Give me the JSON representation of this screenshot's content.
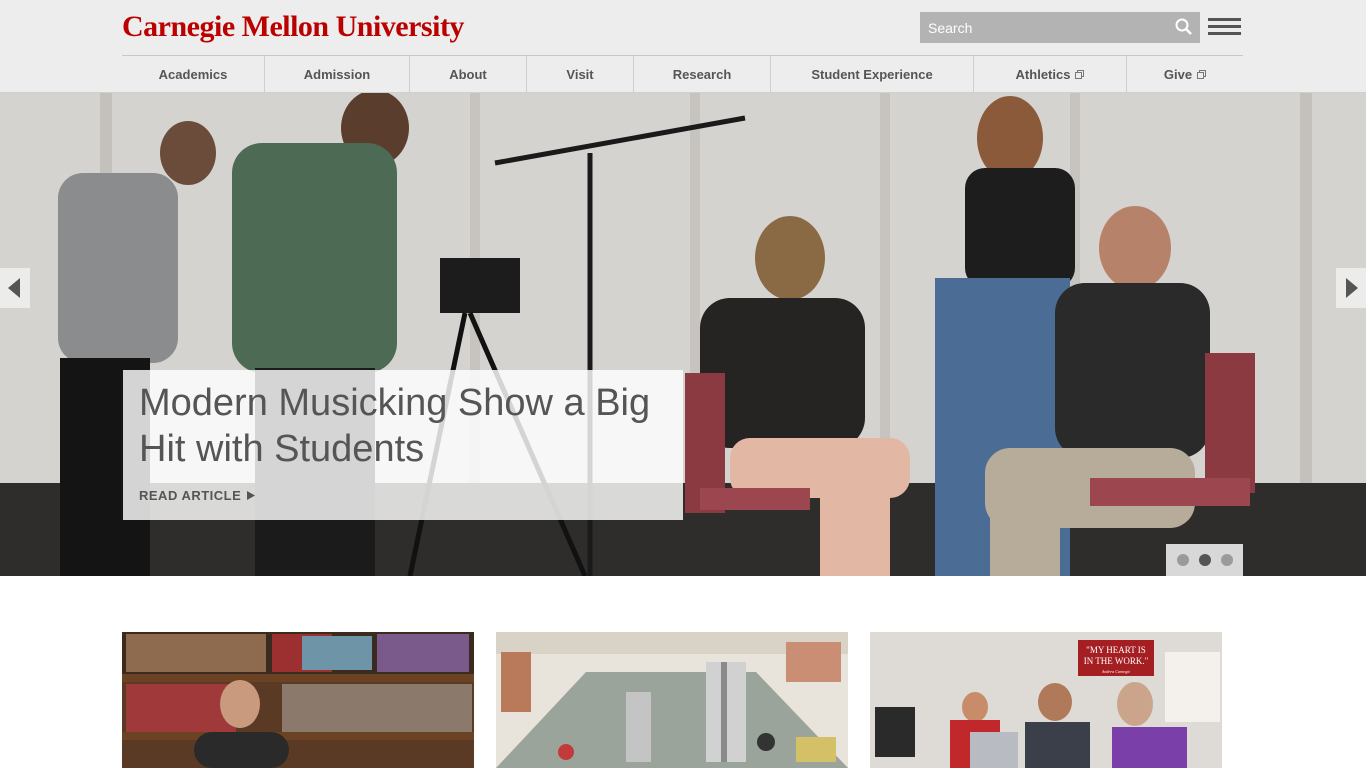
{
  "header": {
    "logo_text": "Carnegie Mellon University",
    "logo_color": "#bb0000",
    "search_placeholder": "Search",
    "nav": [
      {
        "label": "Academics",
        "external": false
      },
      {
        "label": "Admission",
        "external": false
      },
      {
        "label": "About",
        "external": false
      },
      {
        "label": "Visit",
        "external": false
      },
      {
        "label": "Research",
        "external": false
      },
      {
        "label": "Student Experience",
        "external": false
      },
      {
        "label": "Athletics",
        "external": true
      },
      {
        "label": "Give",
        "external": true
      }
    ]
  },
  "hero": {
    "title": "Modern Musicking Show a Big Hit with Students",
    "link_label": "READ ARTICLE",
    "slide_count": 3,
    "active_slide": 2
  },
  "cards": [
    {
      "image": "professor-bookshelf-photo"
    },
    {
      "image": "weight-room-photo"
    },
    {
      "image": "students-laptop-lab-photo",
      "sign_text_1": "\"MY HEART IS",
      "sign_text_2": "IN THE WORK.\"",
      "sign_attribution": "Andrew Carnegie"
    }
  ],
  "icons": {
    "search": "search-icon",
    "menu": "hamburger-menu-icon",
    "external": "external-link-icon",
    "prev": "chevron-left-icon",
    "next": "chevron-right-icon"
  }
}
